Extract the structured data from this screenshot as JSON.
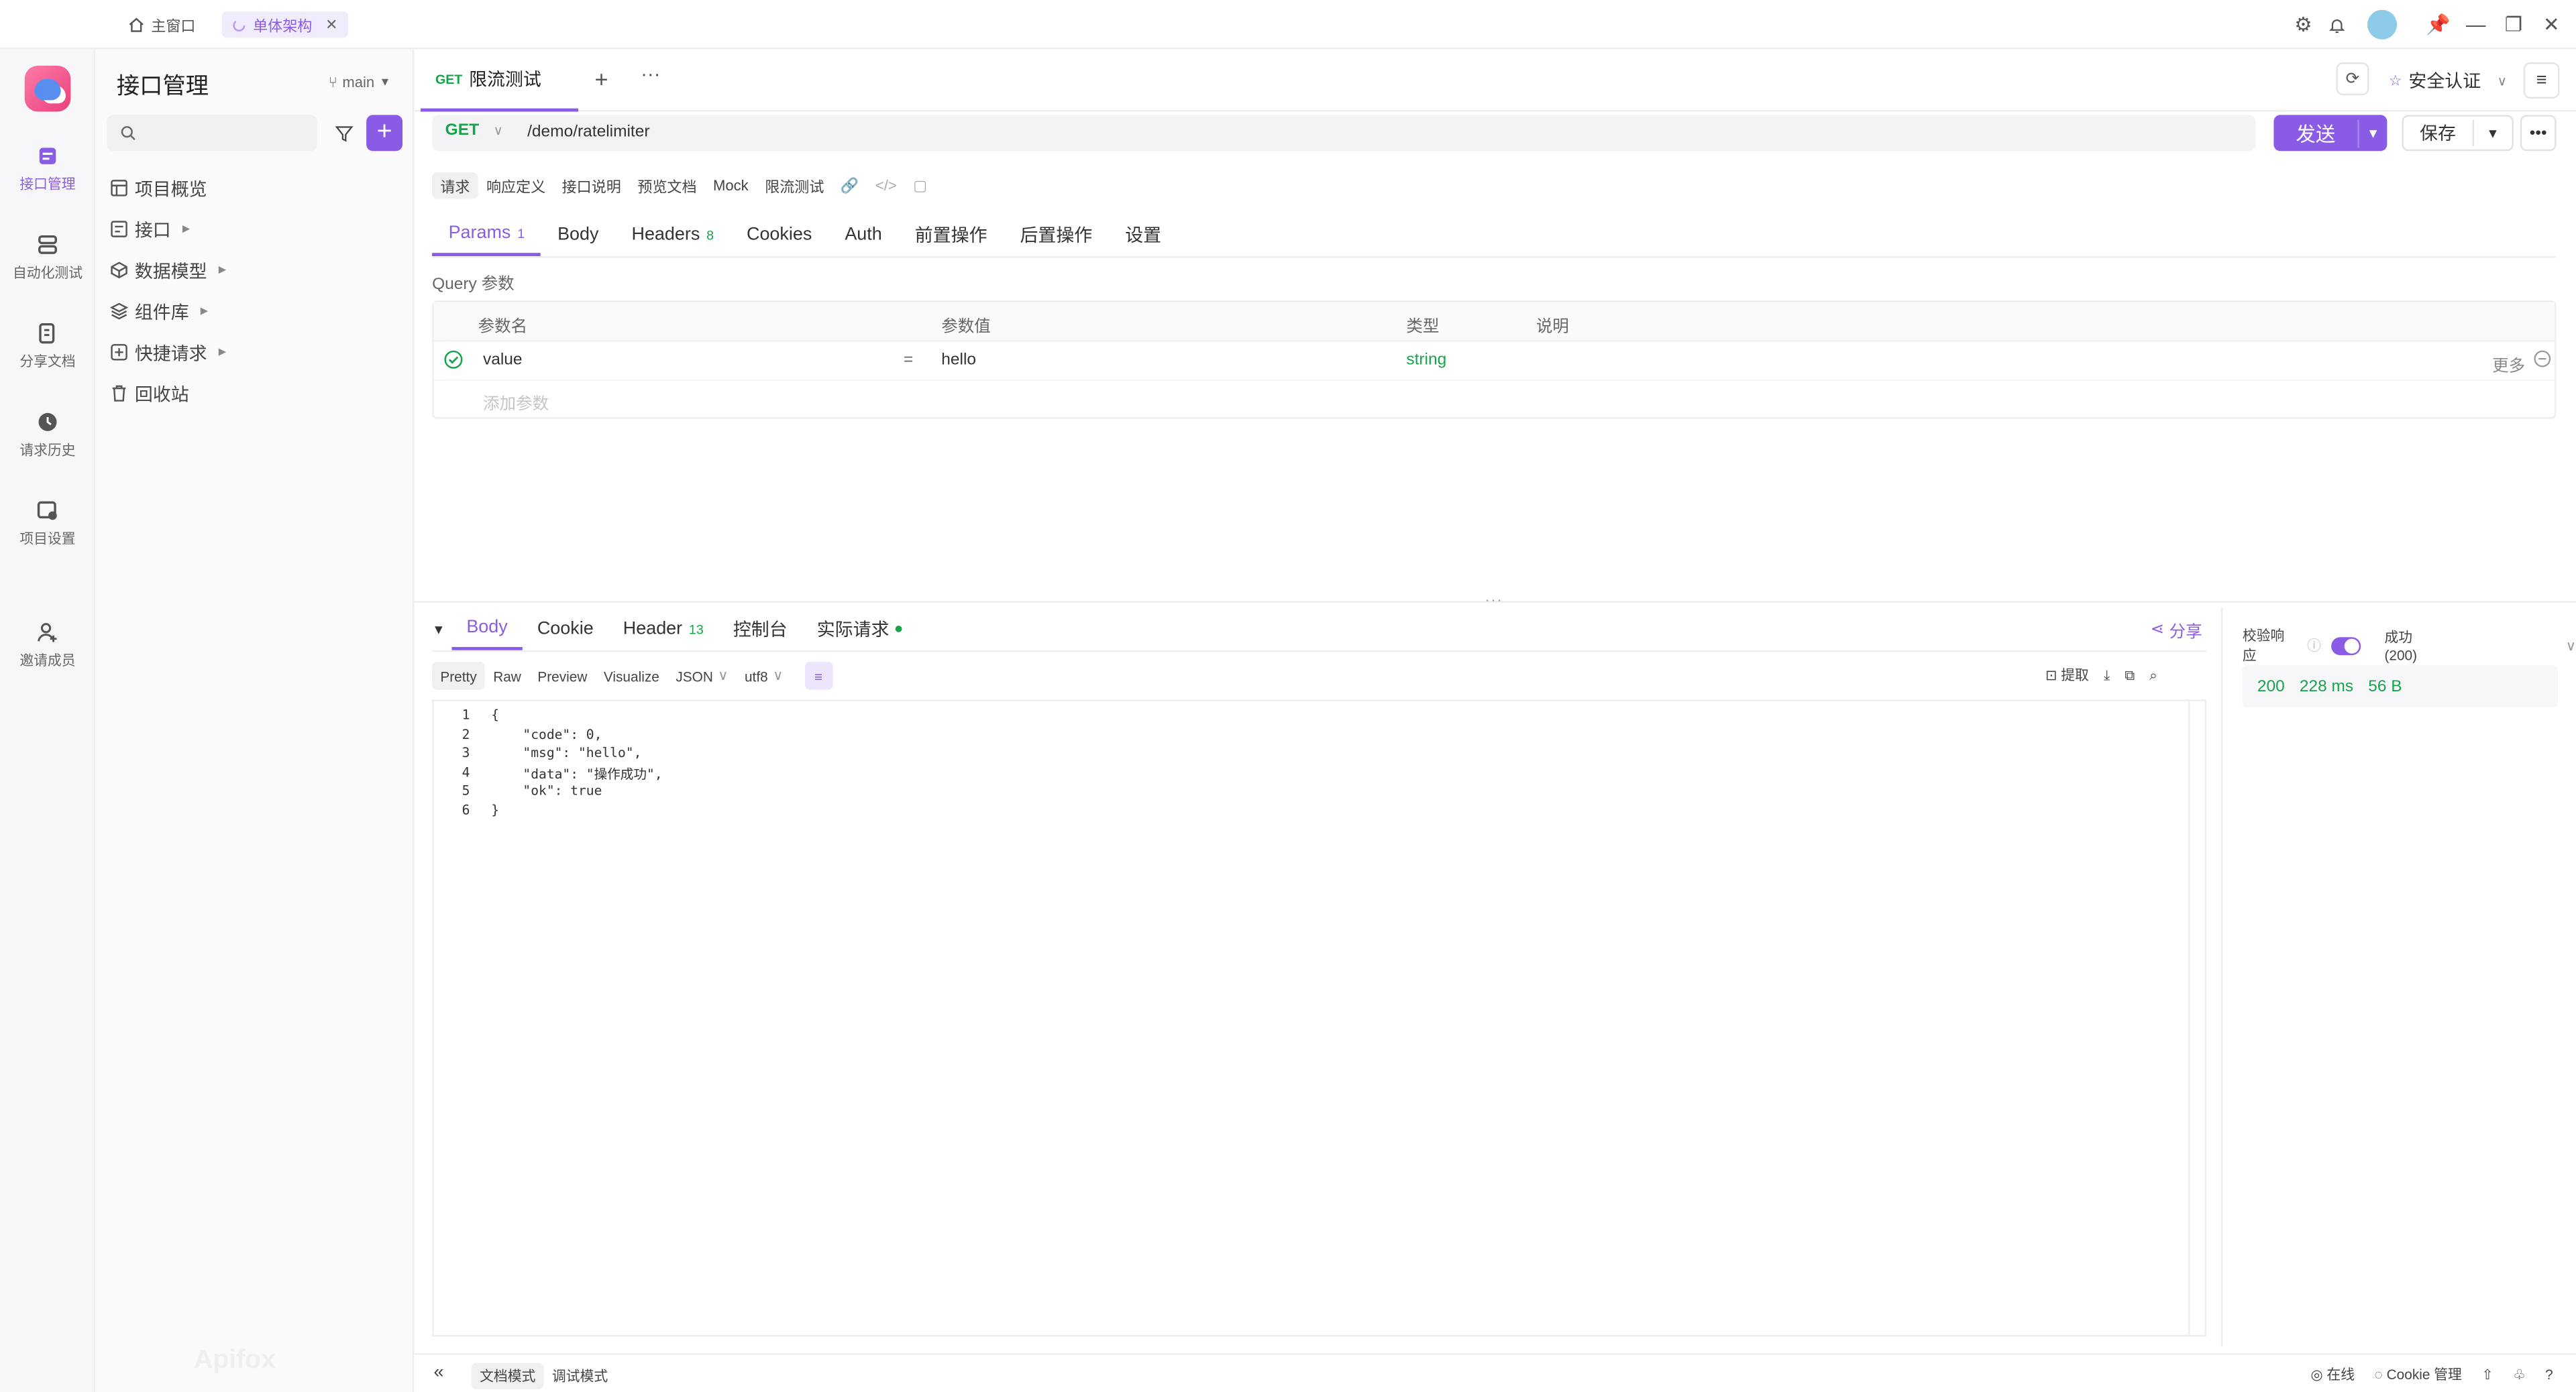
{
  "window_tabs": [
    {
      "label": "主窗口",
      "icon": "home-icon"
    },
    {
      "label": "单体架构",
      "icon": "spinner-icon"
    }
  ],
  "rail": [
    {
      "label": "接口管理",
      "icon": "api-icon",
      "active": true
    },
    {
      "label": "自动化测试",
      "icon": "automation-icon"
    },
    {
      "label": "分享文档",
      "icon": "share-doc-icon"
    },
    {
      "label": "请求历史",
      "icon": "history-icon"
    },
    {
      "label": "项目设置",
      "icon": "project-settings-icon"
    },
    {
      "label": "邀请成员",
      "icon": "invite-member-icon"
    }
  ],
  "sidebar": {
    "title": "接口管理",
    "branch": "main",
    "search_placeholder": "",
    "add_label": "+",
    "tree": [
      {
        "label": "项目概览",
        "icon": "overview-icon",
        "caret": false
      },
      {
        "label": "接口",
        "icon": "api-folder-icon",
        "caret": true
      },
      {
        "label": "数据模型",
        "icon": "data-model-icon",
        "caret": true
      },
      {
        "label": "组件库",
        "icon": "component-icon",
        "caret": true
      },
      {
        "label": "快捷请求",
        "icon": "quick-request-icon",
        "caret": true
      },
      {
        "label": "回收站",
        "icon": "trash-icon",
        "caret": false
      }
    ],
    "watermark": "Apifox"
  },
  "request_tab": {
    "method": "GET",
    "name": "限流测试"
  },
  "environment": "安全认证",
  "urlbar": {
    "method": "GET",
    "url": "/demo/ratelimiter"
  },
  "buttons": {
    "send": "发送",
    "save": "保存"
  },
  "subtabs": [
    "请求",
    "响应定义",
    "接口说明",
    "预览文档",
    "Mock",
    "限流测试"
  ],
  "param_tabs": [
    {
      "label": "Params",
      "count": "1",
      "active": true
    },
    {
      "label": "Body",
      "count": ""
    },
    {
      "label": "Headers",
      "count": "8"
    },
    {
      "label": "Cookies",
      "count": ""
    },
    {
      "label": "Auth",
      "count": ""
    },
    {
      "label": "前置操作",
      "count": ""
    },
    {
      "label": "后置操作",
      "count": ""
    },
    {
      "label": "设置",
      "count": ""
    }
  ],
  "query_label": "Query 参数",
  "params_table": {
    "headers": {
      "name": "参数名",
      "value": "参数值",
      "type": "类型",
      "desc": "说明"
    },
    "rows": [
      {
        "name": "value",
        "eq": "=",
        "value": "hello",
        "type": "string",
        "more": "更多"
      }
    ],
    "add_placeholder": "添加参数"
  },
  "response_tabs": [
    {
      "label": "Body",
      "count": "",
      "active": true
    },
    {
      "label": "Cookie",
      "count": ""
    },
    {
      "label": "Header",
      "count": "13"
    },
    {
      "label": "控制台",
      "count": ""
    },
    {
      "label": "实际请求",
      "count": "",
      "dot": true
    }
  ],
  "share_label": "分享",
  "format_bar": [
    "Pretty",
    "Raw",
    "Preview",
    "Visualize",
    "JSON",
    "utf8"
  ],
  "tools": {
    "extract": "提取"
  },
  "code_lines": [
    {
      "n": "1",
      "t": "{"
    },
    {
      "n": "2",
      "t": "    \"code\": 0,"
    },
    {
      "n": "3",
      "t": "    \"msg\": \"hello\","
    },
    {
      "n": "4",
      "t": "    \"data\": \"操作成功\","
    },
    {
      "n": "5",
      "t": "    \"ok\": true"
    },
    {
      "n": "6",
      "t": "}"
    }
  ],
  "validation": {
    "label": "校验响应",
    "result": "成功 (200)"
  },
  "status": {
    "code": "200",
    "time": "228 ms",
    "size": "56 B"
  },
  "statusbar": {
    "doc_mode": "文档模式",
    "debug_mode": "调试模式",
    "online": "在线",
    "cookie": "Cookie 管理"
  },
  "colors": {
    "accent": "#8a5ce6",
    "success": "#17a34a"
  }
}
